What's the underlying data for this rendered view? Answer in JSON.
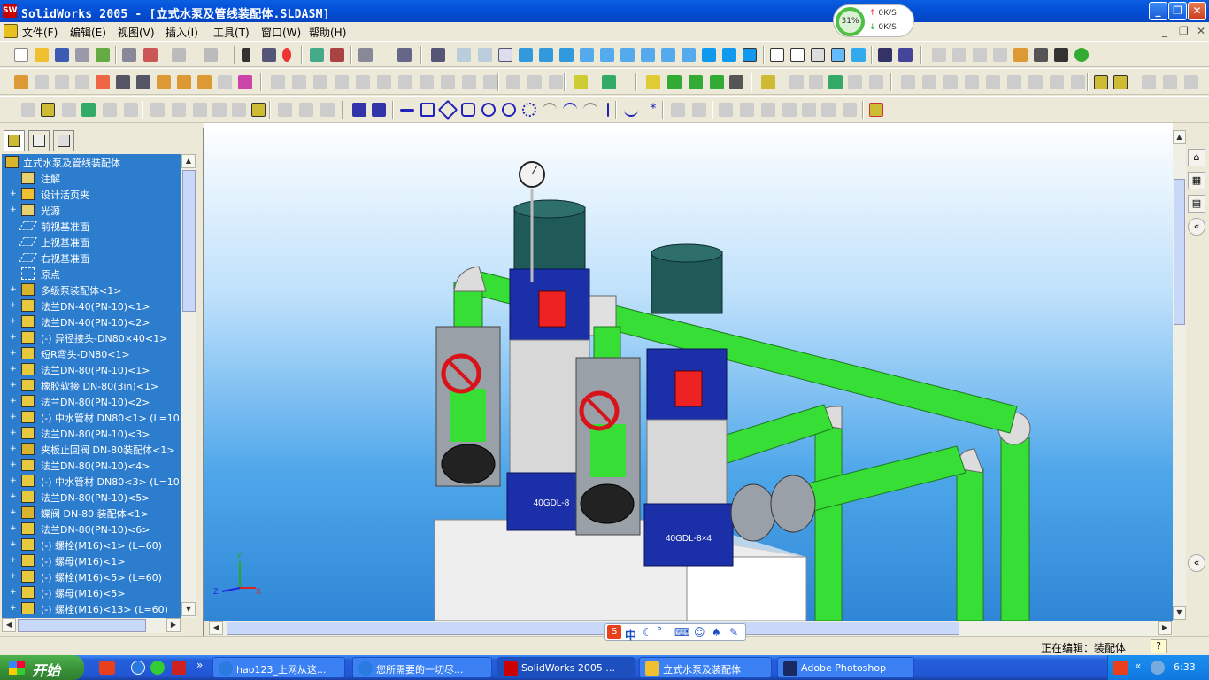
{
  "window": {
    "title": "SolidWorks 2005 - [立式水泵及管线装配体.SLDASM]",
    "app_icon": "solidworks-icon",
    "buttons": [
      "_",
      "❐",
      "✕"
    ]
  },
  "netmon": {
    "percent": "31%",
    "up": "0K/S",
    "down": "0K/S"
  },
  "menu": {
    "items": [
      "文件(F)",
      "编辑(E)",
      "视图(V)",
      "插入(I)",
      "工具(T)",
      "窗口(W)",
      "帮助(H)"
    ],
    "mdi_buttons": [
      "_",
      "❐",
      "✕"
    ]
  },
  "tree": {
    "root": "立式水泵及管线装配体",
    "items": [
      {
        "label": "注解",
        "icon": "annotation-icon",
        "expand": false
      },
      {
        "label": "设计活页夹",
        "icon": "binder-icon",
        "expand": true
      },
      {
        "label": "光源",
        "icon": "lights-icon",
        "expand": true
      },
      {
        "label": "前视基准面",
        "icon": "plane-icon",
        "expand": false
      },
      {
        "label": "上视基准面",
        "icon": "plane-icon",
        "expand": false
      },
      {
        "label": "右视基准面",
        "icon": "plane-icon",
        "expand": false
      },
      {
        "label": "原点",
        "icon": "origin-icon",
        "expand": false
      },
      {
        "label": "多级泵装配体<1>",
        "icon": "assembly-icon",
        "expand": true
      },
      {
        "label": "法兰DN-40(PN-10)<1>",
        "icon": "part-icon",
        "expand": true
      },
      {
        "label": "法兰DN-40(PN-10)<2>",
        "icon": "part-icon",
        "expand": true
      },
      {
        "label": "(-) 异径接头-DN80×40<1>",
        "icon": "part-icon",
        "expand": true
      },
      {
        "label": "短R弯头-DN80<1>",
        "icon": "part-icon",
        "expand": true
      },
      {
        "label": "法兰DN-80(PN-10)<1>",
        "icon": "part-icon",
        "expand": true
      },
      {
        "label": "橡胶软接 DN-80(3in)<1>",
        "icon": "part-icon",
        "expand": true
      },
      {
        "label": "法兰DN-80(PN-10)<2>",
        "icon": "part-icon",
        "expand": true
      },
      {
        "label": "(-) 中水管材 DN80<1> (L=10",
        "icon": "part-icon",
        "expand": true
      },
      {
        "label": "法兰DN-80(PN-10)<3>",
        "icon": "part-icon",
        "expand": true
      },
      {
        "label": "夹板止回阀 DN-80装配体<1>",
        "icon": "assembly-icon",
        "expand": true
      },
      {
        "label": "法兰DN-80(PN-10)<4>",
        "icon": "part-icon",
        "expand": true
      },
      {
        "label": "(-) 中水管材 DN80<3> (L=10",
        "icon": "part-icon",
        "expand": true
      },
      {
        "label": "法兰DN-80(PN-10)<5>",
        "icon": "part-icon",
        "expand": true
      },
      {
        "label": "蝶阀 DN-80 装配体<1>",
        "icon": "assembly-icon",
        "expand": true
      },
      {
        "label": "法兰DN-80(PN-10)<6>",
        "icon": "part-icon",
        "expand": true
      },
      {
        "label": "(-) 螺栓(M16)<1> (L=60)",
        "icon": "part-icon",
        "expand": true
      },
      {
        "label": "(-) 螺母(M16)<1>",
        "icon": "part-icon",
        "expand": true
      },
      {
        "label": "(-) 螺栓(M16)<5> (L=60)",
        "icon": "part-icon",
        "expand": true
      },
      {
        "label": "(-) 螺母(M16)<5>",
        "icon": "part-icon",
        "expand": true
      },
      {
        "label": "(-) 螺栓(M16)<13> (L=60)",
        "icon": "part-icon",
        "expand": true
      }
    ]
  },
  "model": {
    "pump_label_1": "40GDL-8",
    "pump_label_2": "40GDL-8×4",
    "axes": {
      "x": "X",
      "y": "Y",
      "z": "Z"
    }
  },
  "status": {
    "text": "正在编辑：装配体"
  },
  "taskbar": {
    "start": "开始",
    "tasks": [
      {
        "label": "hao123_上网从这...",
        "icon": "ie-icon"
      },
      {
        "label": "您所需要的一切尽...",
        "icon": "ie-icon"
      },
      {
        "label": "SolidWorks 2005 ...",
        "icon": "solidworks-icon"
      },
      {
        "label": "立式水泵及装配体",
        "icon": "folder-icon"
      },
      {
        "label": "Adobe Photoshop",
        "icon": "photoshop-icon"
      }
    ],
    "clock": "6:33"
  },
  "ime": {
    "label": "中"
  },
  "colors": {
    "pipe": "#3de03a",
    "pump_blue": "#1b2fa8",
    "motor": "#1f5a58",
    "tree_bg": "#2d7dcf",
    "valve_red": "#d8141b"
  }
}
